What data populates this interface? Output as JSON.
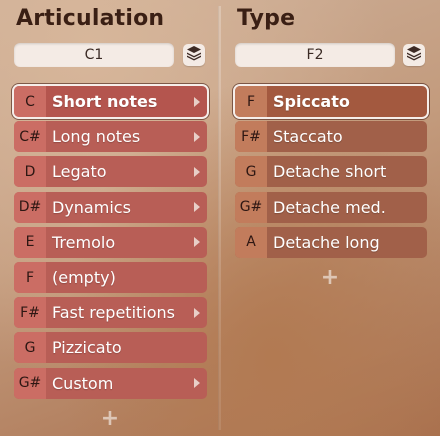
{
  "articulation": {
    "title": "Articulation",
    "note": "C1",
    "rows": [
      {
        "key": "C",
        "label": "Short notes",
        "has_submenu": true,
        "selected": true
      },
      {
        "key": "C#",
        "label": "Long notes",
        "has_submenu": true,
        "selected": false
      },
      {
        "key": "D",
        "label": "Legato",
        "has_submenu": true,
        "selected": false
      },
      {
        "key": "D#",
        "label": "Dynamics",
        "has_submenu": true,
        "selected": false
      },
      {
        "key": "E",
        "label": "Tremolo",
        "has_submenu": true,
        "selected": false
      },
      {
        "key": "F",
        "label": "(empty)",
        "has_submenu": false,
        "selected": false
      },
      {
        "key": "F#",
        "label": "Fast repetitions",
        "has_submenu": true,
        "selected": false
      },
      {
        "key": "G",
        "label": "Pizzicato",
        "has_submenu": false,
        "selected": false
      },
      {
        "key": "G#",
        "label": "Custom",
        "has_submenu": true,
        "selected": false
      }
    ],
    "add_label": "+"
  },
  "type": {
    "title": "Type",
    "note": "F2",
    "rows": [
      {
        "key": "F",
        "label": "Spiccato",
        "has_submenu": false,
        "selected": true
      },
      {
        "key": "F#",
        "label": "Staccato",
        "has_submenu": false,
        "selected": false
      },
      {
        "key": "G",
        "label": "Detache short",
        "has_submenu": false,
        "selected": false
      },
      {
        "key": "G#",
        "label": "Detache med.",
        "has_submenu": false,
        "selected": false
      },
      {
        "key": "A",
        "label": "Detache long",
        "has_submenu": false,
        "selected": false
      }
    ],
    "add_label": "+"
  },
  "icons": {
    "layers": "layers-icon",
    "submenu": "chevron-right-icon"
  }
}
